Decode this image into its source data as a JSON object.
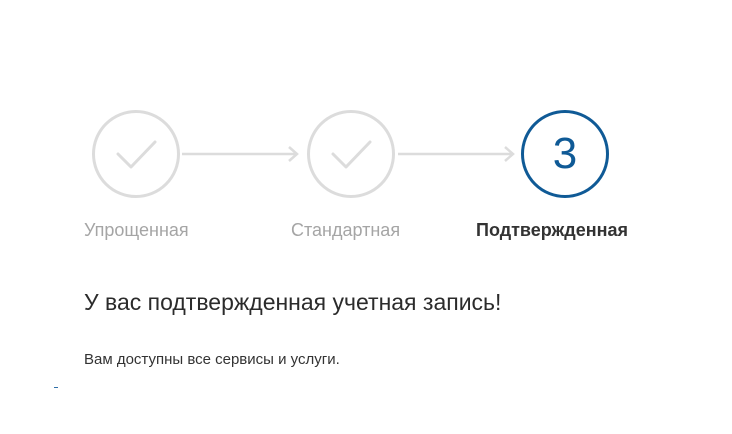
{
  "stepper": {
    "steps": [
      {
        "label": "Упрощенная",
        "state": "completed",
        "icon": "checkmark-icon"
      },
      {
        "label": "Стандартная",
        "state": "completed",
        "icon": "checkmark-icon"
      },
      {
        "label": "Подтвержденная",
        "state": "active",
        "number": "3"
      }
    ],
    "connector_icon": "arrow-right-icon"
  },
  "content": {
    "headline": "У вас подтвержденная учетная запись!",
    "subtext": "Вам доступны все сервисы и услуги."
  },
  "colors": {
    "completed": "#dcdcdc",
    "active": "#0f5a96",
    "completed_label": "#a5a5a5",
    "active_label": "#333333"
  }
}
